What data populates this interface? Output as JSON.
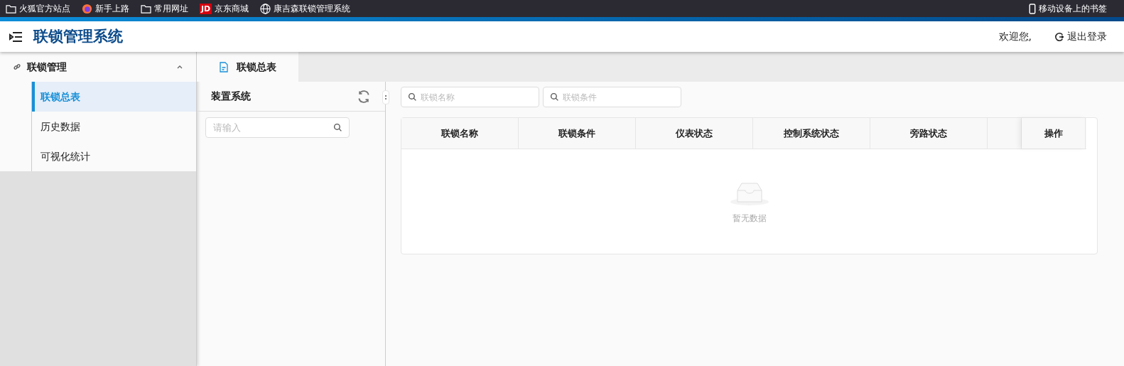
{
  "bookmarks": [
    {
      "kind": "folder",
      "label": "火狐官方站点"
    },
    {
      "kind": "firefox",
      "label": "新手上路"
    },
    {
      "kind": "folder",
      "label": "常用网址"
    },
    {
      "kind": "jd",
      "badge": "JD",
      "label": "京东商城"
    },
    {
      "kind": "globe",
      "label": "康吉森联锁管理系统"
    }
  ],
  "mobile_bookmarks": "移动设备上的书签",
  "header": {
    "title": "联锁管理系统",
    "welcome": "欢迎您,",
    "logout": "退出登录"
  },
  "sidebar": {
    "group": {
      "label": "联锁管理",
      "expanded": true,
      "children": [
        {
          "label": "联锁总表",
          "selected": true
        },
        {
          "label": "历史数据",
          "selected": false
        },
        {
          "label": "可视化统计",
          "selected": false
        }
      ]
    }
  },
  "tabs": [
    {
      "label": "联锁总表",
      "selected": true
    }
  ],
  "tree_panel": {
    "title": "装置系统",
    "search_placeholder": "请输入"
  },
  "filters": [
    {
      "placeholder": "联锁名称"
    },
    {
      "placeholder": "联锁条件"
    }
  ],
  "table": {
    "columns": [
      "联锁名称",
      "联锁条件",
      "仪表状态",
      "控制系统状态",
      "旁路状态",
      "",
      "操作"
    ],
    "empty_text": "暂无数据"
  }
}
